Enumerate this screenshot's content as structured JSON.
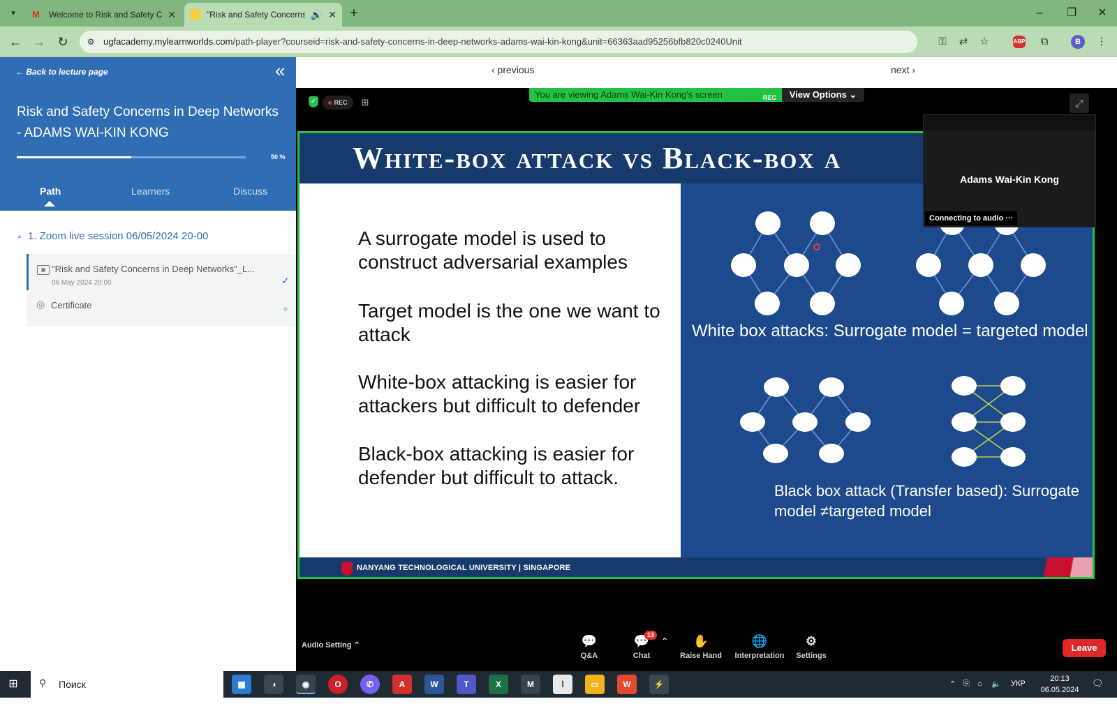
{
  "browser": {
    "tabs": [
      {
        "title": "Welcome to Risk and Safety Co"
      },
      {
        "title": "\"Risk and Safety Concerns"
      }
    ],
    "url_main": "ugfacademy.mylearnworlds.com",
    "url_rest": "/path-player?courseid=risk-and-safety-concerns-in-deep-networks-adams-wai-kin-kong&unit=66363aad95256bfb820c0240Unit",
    "profile_initial": "B",
    "abp_label": "ABP"
  },
  "sidebar": {
    "back_label": "Back to lecture page",
    "course_title": "Risk and Safety Concerns in Deep Networks - ADAMS WAI-KIN KONG",
    "progress_value": 0.5,
    "progress_label": "50 %",
    "tabs": [
      {
        "label": "Path"
      },
      {
        "label": "Learners"
      },
      {
        "label": "Discuss"
      }
    ],
    "section_title": "1. Zoom live session 06/05/2024 20-00",
    "items": [
      {
        "name": "\"Risk and Safety Concerns in Deep Networks\"_L...",
        "date": "06 May 2024 20:00"
      },
      {
        "name": "Certificate"
      }
    ]
  },
  "nav": {
    "previous": "‹ previous",
    "next": "next ›"
  },
  "zoom": {
    "rec_label": "REC",
    "banner_text": "You are viewing Adams Wai-Kin Kong's screen",
    "banner_rec": "REC",
    "view_options": "View Options",
    "participant_name": "Adams Wai-Kin Kong",
    "participant_status": "Connecting to audio ···",
    "audio_setting": "Audio Setting",
    "toolbar": [
      {
        "label": "Q&A"
      },
      {
        "label": "Chat",
        "badge": "13"
      },
      {
        "label": "Raise Hand"
      },
      {
        "label": "Interpretation"
      },
      {
        "label": "Settings"
      }
    ],
    "leave": "Leave"
  },
  "slide": {
    "title": "White-box attack vs Black-box a",
    "bullets": [
      "A surrogate model is used to construct adversarial examples",
      "Target model is the one we want to attack",
      "White-box attacking is easier for attackers but difficult to defender",
      "Black-box attacking is easier for defender but difficult to attack."
    ],
    "caption_white": "White box attacks: Surrogate model = targeted model",
    "caption_black": "Black box attack (Transfer based): Surrogate model ≠targeted model",
    "footer": "NANYANG TECHNOLOGICAL UNIVERSITY | SINGAPORE",
    "colors": {
      "title_bar": "#163a6b",
      "panel": "#1d4a8c",
      "frame": "#23c244"
    }
  },
  "taskbar": {
    "search_placeholder": "Поиск",
    "language": "УКР",
    "time": "20:13",
    "date": "06.05.2024"
  }
}
